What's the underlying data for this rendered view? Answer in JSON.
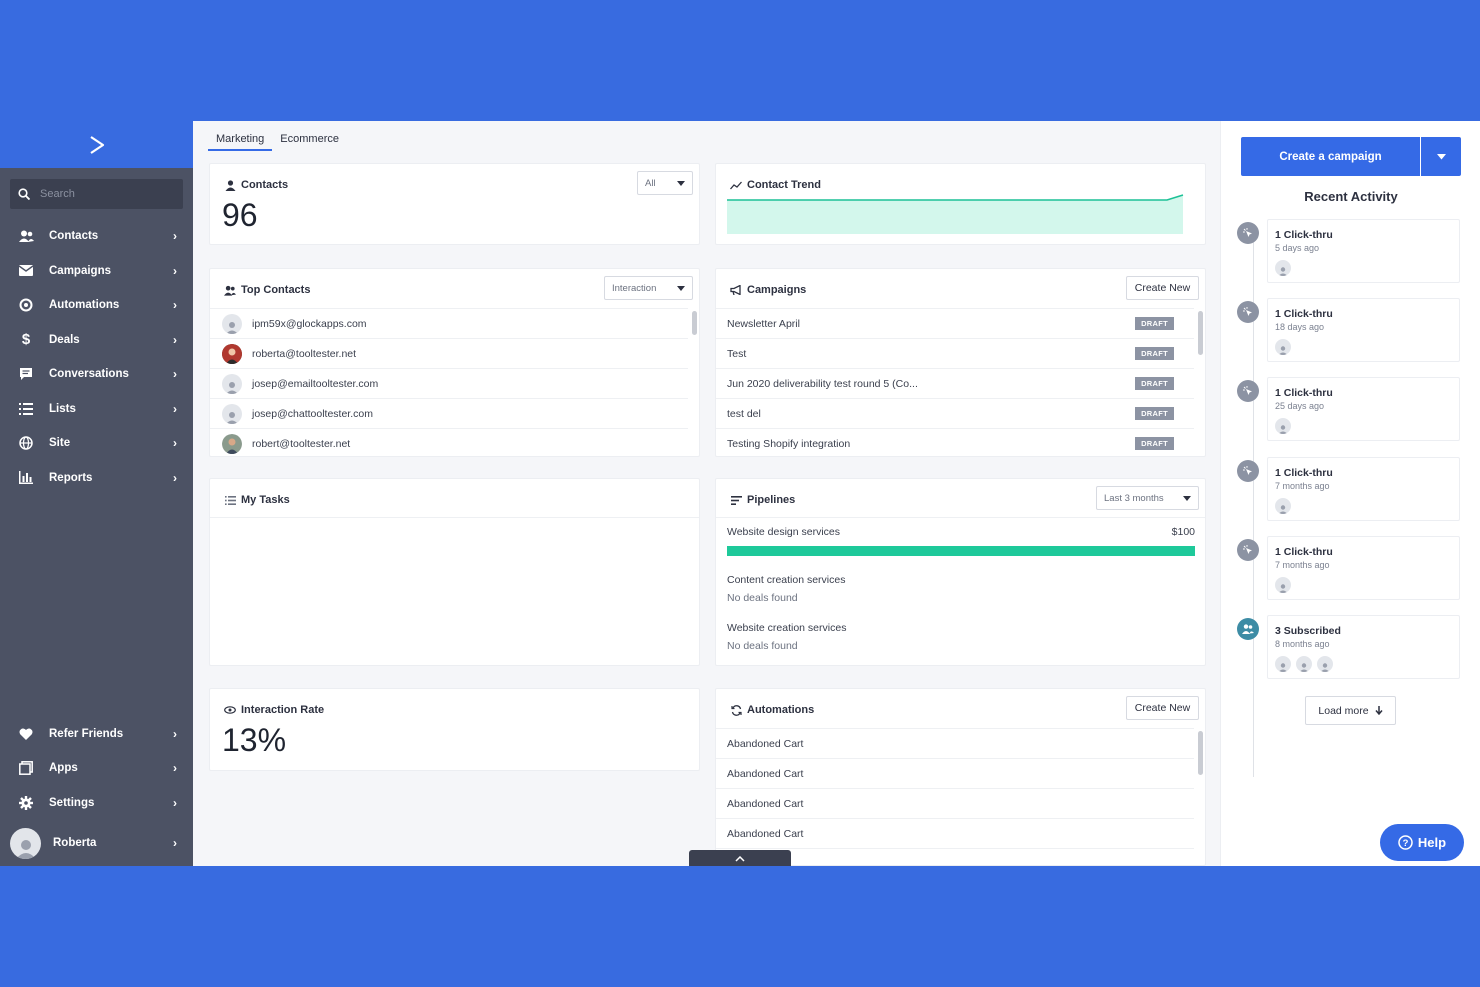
{
  "sidebar": {
    "search_placeholder": "Search",
    "items": [
      {
        "label": "Contacts",
        "icon": "contacts-icon"
      },
      {
        "label": "Campaigns",
        "icon": "envelope-icon"
      },
      {
        "label": "Automations",
        "icon": "automation-icon"
      },
      {
        "label": "Deals",
        "icon": "dollar-icon"
      },
      {
        "label": "Conversations",
        "icon": "chat-icon"
      },
      {
        "label": "Lists",
        "icon": "list-icon"
      },
      {
        "label": "Site",
        "icon": "globe-icon"
      },
      {
        "label": "Reports",
        "icon": "bar-chart-icon"
      }
    ],
    "bottom_items": [
      {
        "label": "Refer Friends",
        "icon": "heart-icon"
      },
      {
        "label": "Apps",
        "icon": "apps-icon"
      },
      {
        "label": "Settings",
        "icon": "gear-icon"
      }
    ],
    "user": "Roberta"
  },
  "tabs": [
    "Marketing",
    "Ecommerce"
  ],
  "contacts_card": {
    "title": "Contacts",
    "filter": "All",
    "count": "96"
  },
  "trend_card": {
    "title": "Contact Trend"
  },
  "top_contacts": {
    "title": "Top Contacts",
    "filter": "Interaction",
    "rows": [
      "ipm59x@glockapps.com",
      "roberta@tooltester.net",
      "josep@emailtooltester.com",
      "josep@chattooltester.com",
      "robert@tooltester.net"
    ]
  },
  "campaigns": {
    "title": "Campaigns",
    "button": "Create New",
    "rows": [
      {
        "name": "Newsletter April",
        "status": "DRAFT"
      },
      {
        "name": "Test",
        "status": "DRAFT"
      },
      {
        "name": "Jun 2020 deliverability test round 5 (Co...",
        "status": "DRAFT"
      },
      {
        "name": "test del",
        "status": "DRAFT"
      },
      {
        "name": "Testing Shopify integration",
        "status": "DRAFT"
      }
    ]
  },
  "tasks": {
    "title": "My Tasks"
  },
  "pipelines": {
    "title": "Pipelines",
    "filter": "Last 3 months",
    "items": [
      {
        "name": "Website design services",
        "value": "$100",
        "fill": 1.0
      },
      {
        "name": "Content creation services",
        "note": "No deals found"
      },
      {
        "name": "Website creation services",
        "note": "No deals found"
      }
    ]
  },
  "interaction": {
    "title": "Interaction Rate",
    "value": "13%"
  },
  "automations": {
    "title": "Automations",
    "button": "Create New",
    "rows": [
      "Abandoned Cart",
      "Abandoned Cart",
      "Abandoned Cart",
      "Abandoned Cart"
    ]
  },
  "right": {
    "create_label": "Create a campaign",
    "activity_title": "Recent Activity",
    "activities": [
      {
        "title": "1 Click-thru",
        "time": "5 days ago",
        "avatars": 1,
        "kind": "click"
      },
      {
        "title": "1 Click-thru",
        "time": "18 days ago",
        "avatars": 1,
        "kind": "click"
      },
      {
        "title": "1 Click-thru",
        "time": "25 days ago",
        "avatars": 1,
        "kind": "click"
      },
      {
        "title": "1 Click-thru",
        "time": "7 months ago",
        "avatars": 1,
        "kind": "click"
      },
      {
        "title": "1 Click-thru",
        "time": "7 months ago",
        "avatars": 1,
        "kind": "click"
      },
      {
        "title": "3 Subscribed",
        "time": "8 months ago",
        "avatars": 3,
        "kind": "subscribe"
      }
    ],
    "load_more": "Load more",
    "help": "Help"
  },
  "colors": {
    "brand": "#356ae6",
    "sidebar": "#4c5264",
    "trend_fill": "#d3f7ec",
    "trend_line": "#1cc196",
    "pipeline_bar": "#1ec99a",
    "badge": "#8c93a3"
  }
}
